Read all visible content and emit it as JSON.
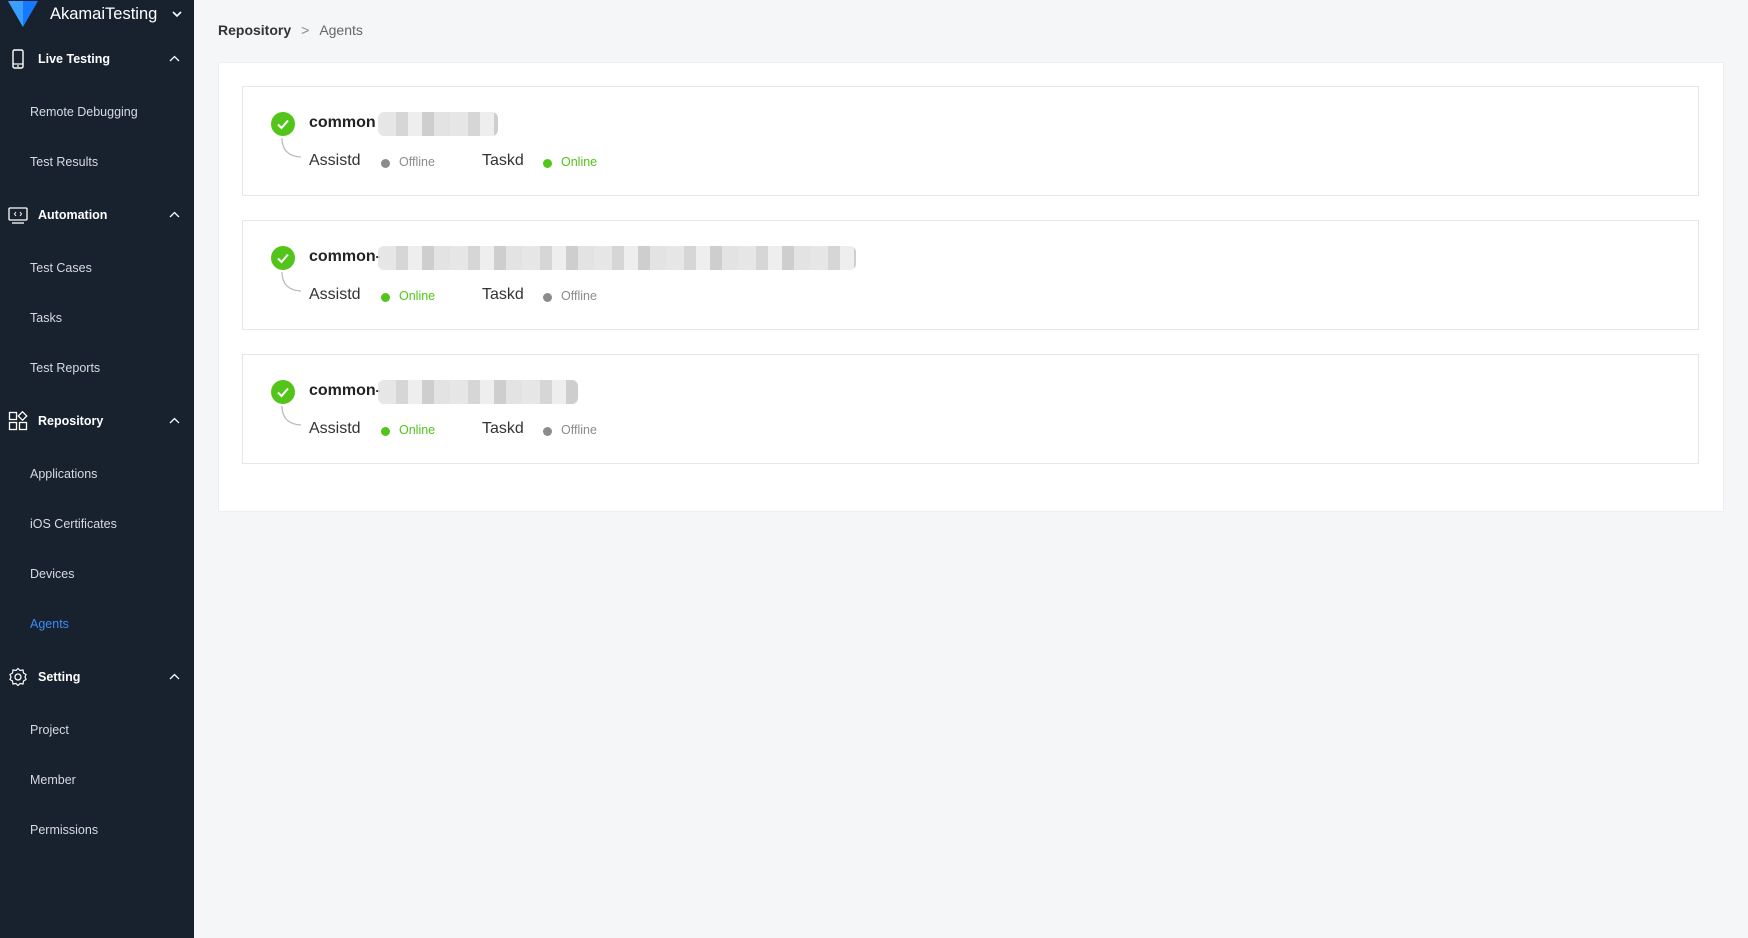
{
  "app": {
    "name": "AkamaiTesting"
  },
  "sidebar": {
    "sections": [
      {
        "label": "Live Testing",
        "icon": "mobile-phone-icon",
        "items": [
          "Remote Debugging",
          "Test Results"
        ]
      },
      {
        "label": "Automation",
        "icon": "monitor-code-icon",
        "items": [
          "Test Cases",
          "Tasks",
          "Test Reports"
        ]
      },
      {
        "label": "Repository",
        "icon": "grid-shapes-icon",
        "items": [
          "Applications",
          "iOS Certificates",
          "Devices",
          "Agents"
        ]
      },
      {
        "label": "Setting",
        "icon": "gear-icon",
        "items": [
          "Project",
          "Member",
          "Permissions"
        ]
      }
    ],
    "active_item": "Agents"
  },
  "breadcrumb": {
    "root": "Repository",
    "separator": ">",
    "current": "Agents"
  },
  "agents": [
    {
      "name": "common",
      "services": [
        {
          "label": "Assistd",
          "status": "Offline"
        },
        {
          "label": "Taskd",
          "status": "Online"
        }
      ]
    },
    {
      "name": "common-",
      "services": [
        {
          "label": "Assistd",
          "status": "Online"
        },
        {
          "label": "Taskd",
          "status": "Offline"
        }
      ]
    },
    {
      "name": "common-",
      "services": [
        {
          "label": "Assistd",
          "status": "Online"
        },
        {
          "label": "Taskd",
          "status": "Offline"
        }
      ]
    }
  ],
  "colors": {
    "sidebar_bg": "#18212e",
    "active": "#3e8bf7",
    "online": "#52c41a",
    "offline": "#8c8c8c"
  }
}
